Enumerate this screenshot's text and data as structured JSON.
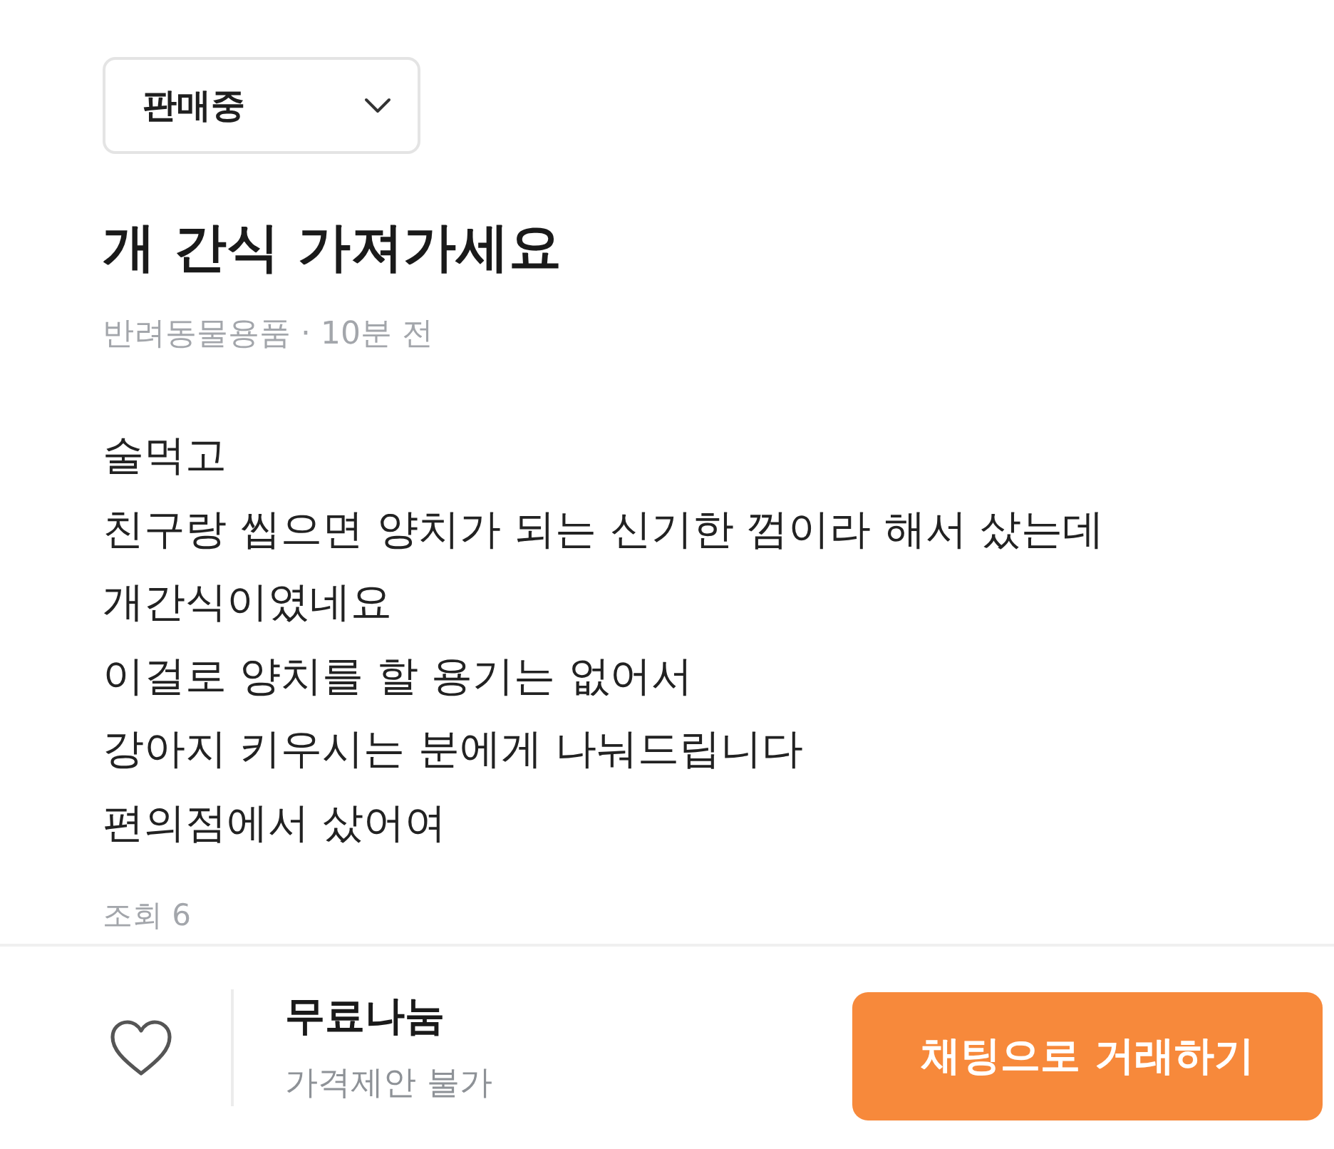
{
  "status_dropdown": {
    "value": "판매중"
  },
  "title": "개 간식 가져가세요",
  "meta": "반려동물용품 · 10분 전",
  "description_lines": [
    "술먹고",
    "친구랑 씹으면 양치가 되는 신기한 껌이라 해서 샀는데",
    "개간식이였네요",
    "이걸로 양치를 할 용기는 없어서",
    "강아지 키우시는 분에게 나눠드립니다",
    "편의점에서 샀어여"
  ],
  "views": "조회 6",
  "bottom_bar": {
    "liked": false,
    "price": "무료나눔",
    "price_offer": "가격제안 불가",
    "chat_button": "채팅으로 거래하기"
  }
}
